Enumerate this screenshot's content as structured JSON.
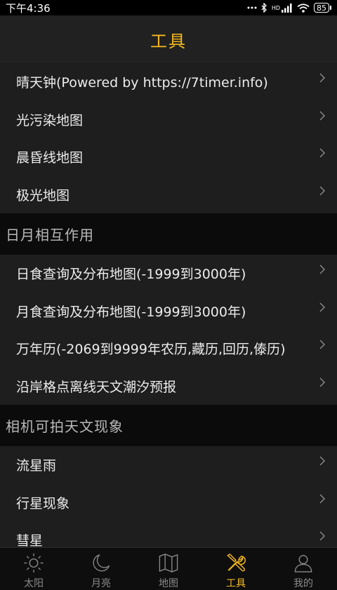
{
  "status_bar": {
    "time": "下午4:36",
    "network": "HD",
    "battery": "85"
  },
  "header": {
    "title": "工具"
  },
  "groups": [
    {
      "section": "",
      "items": [
        {
          "label": "晴天钟(Powered by https://7timer.info)"
        },
        {
          "label": "光污染地图"
        },
        {
          "label": "晨昏线地图"
        },
        {
          "label": "极光地图"
        }
      ]
    },
    {
      "section": "日月相互作用",
      "items": [
        {
          "label": "日食查询及分布地图(-1999到3000年)"
        },
        {
          "label": "月食查询及分布地图(-1999到3000年)"
        },
        {
          "label": "万年历(-2069到9999年农历,藏历,回历,傣历)"
        },
        {
          "label": "沿岸格点离线天文潮汐预报"
        }
      ]
    },
    {
      "section": "相机可拍天文现象",
      "items": [
        {
          "label": "流星雨"
        },
        {
          "label": "行星现象"
        },
        {
          "label": "彗星"
        }
      ]
    }
  ],
  "tabbar": {
    "tabs": [
      {
        "label": "太阳",
        "icon": "sun-icon"
      },
      {
        "label": "月亮",
        "icon": "moon-icon"
      },
      {
        "label": "地图",
        "icon": "map-icon"
      },
      {
        "label": "工具",
        "icon": "tools-icon",
        "active": true
      },
      {
        "label": "我的",
        "icon": "user-icon"
      }
    ]
  },
  "colors": {
    "accent": "#f5b91f",
    "row_bg": "#1e1e1e",
    "section_bg": "#0b0b0b",
    "header_bg": "#212121"
  }
}
